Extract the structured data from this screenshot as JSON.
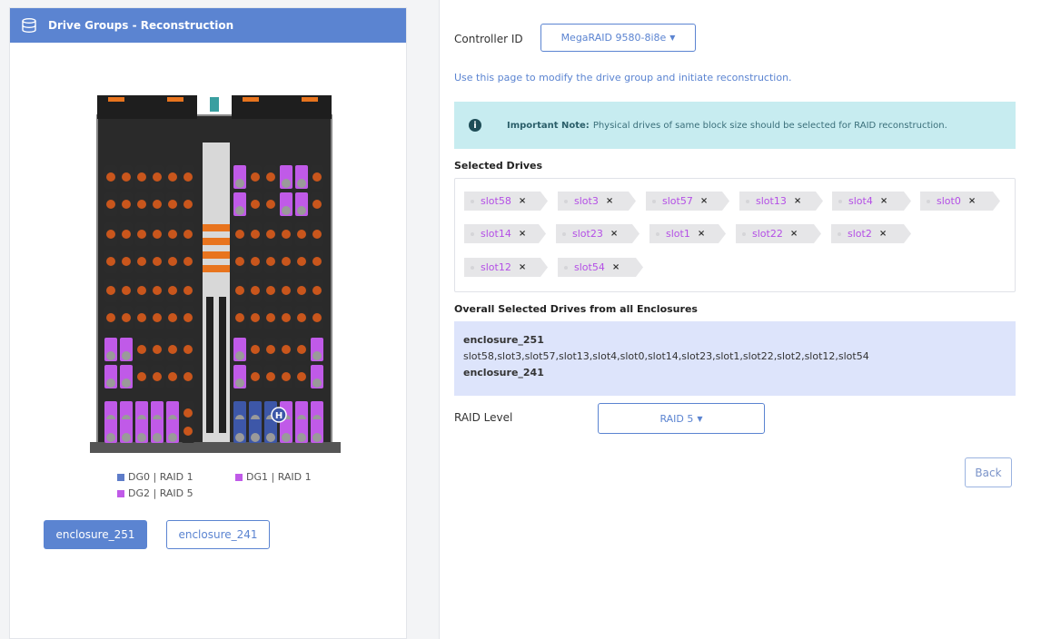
{
  "left_panel": {
    "title": "Drive Groups - Reconstruction",
    "legend": [
      {
        "label": "DG0 | RAID 1",
        "color": "#5e7cc9"
      },
      {
        "label": "DG1 | RAID 1",
        "color": "#c05ae8"
      },
      {
        "label": "DG2 | RAID 5",
        "color": "#c05ae8"
      }
    ],
    "enclosure_buttons": [
      {
        "label": "enclosure_251",
        "active": true
      },
      {
        "label": "enclosure_241",
        "active": false
      }
    ],
    "hotspare_badge": "H"
  },
  "right_panel": {
    "controller_label": "Controller ID",
    "controller_value": "MegaRAID 9580-8i8e",
    "intro": "Use this page to modify the drive group and initiate reconstruction.",
    "note_bold": "Important Note:",
    "note_text": "Physical drives of same block size should be selected for RAID reconstruction.",
    "note_icon": "i",
    "selected_title": "Selected Drives",
    "selected_drives": [
      "slot58",
      "slot3",
      "slot57",
      "slot13",
      "slot4",
      "slot0",
      "slot14",
      "slot23",
      "slot1",
      "slot22",
      "slot2",
      "slot12",
      "slot54"
    ],
    "chip_remove": "×",
    "overall_title": "Overall Selected Drives from all Enclosures",
    "overall": [
      {
        "enclosure": "enclosure_251",
        "slots": "slot58,slot3,slot57,slot13,slot4,slot0,slot14,slot23,slot1,slot22,slot2,slot12,slot54"
      },
      {
        "enclosure": "enclosure_241",
        "slots": ""
      }
    ],
    "raid_label": "RAID Level",
    "raid_value": "RAID 5",
    "back_label": "Back"
  },
  "colors": {
    "accent": "#5b84d1",
    "chip_text": "#b44fe6",
    "note_bg": "#c7ecf0",
    "overall_bg": "#dde4fb"
  }
}
